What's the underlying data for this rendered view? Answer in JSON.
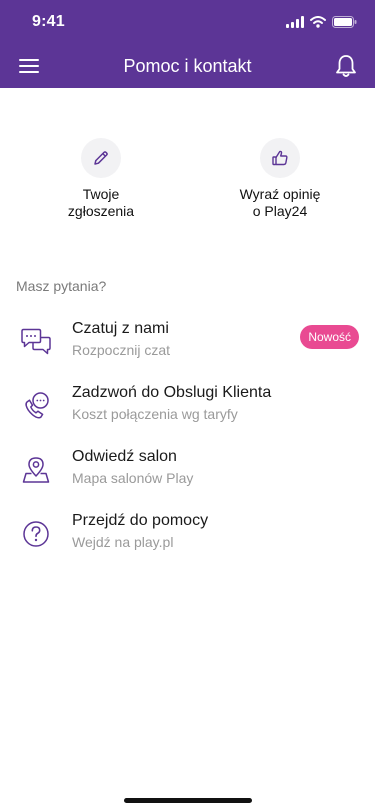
{
  "status_bar": {
    "time": "9:41"
  },
  "header": {
    "title": "Pomoc i kontakt"
  },
  "shortcuts": [
    {
      "label": "Twoje\nzgłoszenia",
      "icon": "pencil-icon"
    },
    {
      "label": "Wyraź opinię\no Play24",
      "icon": "thumbs-up-icon"
    }
  ],
  "section": {
    "title": "Masz pytania?"
  },
  "contact_items": [
    {
      "title": "Czatuj z nami",
      "subtitle": "Rozpocznij czat",
      "icon": "chat-bubbles-icon",
      "badge": "Nowość"
    },
    {
      "title": "Zadzwoń do Obslugi Klienta",
      "subtitle": "Koszt połączenia wg taryfy",
      "icon": "phone-call-icon"
    },
    {
      "title": "Odwiedź salon",
      "subtitle": "Mapa salonów Play",
      "icon": "location-pin-icon"
    },
    {
      "title": "Przejdź do pomocy",
      "subtitle": "Wejdź na play.pl",
      "icon": "help-question-icon"
    }
  ],
  "colors": {
    "brand": "#5c3596",
    "accent": "#e94a92",
    "icon": "#5c3596"
  }
}
